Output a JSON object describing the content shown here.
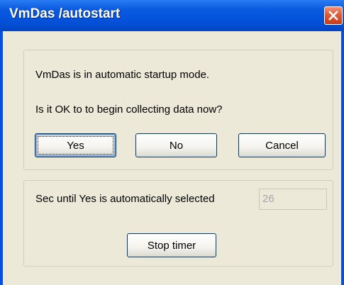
{
  "window": {
    "title": "VmDas /autostart",
    "close_icon": "close-icon",
    "colors": {
      "titlebar": "#0451d9",
      "close_button": "#e05a36",
      "client_background": "#ece9d8"
    }
  },
  "prompt": {
    "line1": "VmDas is in automatic startup mode.",
    "line2": "Is it OK to to begin collecting data now?"
  },
  "buttons": {
    "yes": "Yes",
    "no": "No",
    "cancel": "Cancel",
    "stop_timer": "Stop timer"
  },
  "timer": {
    "label": "Sec until Yes is automatically selected",
    "value": "26"
  }
}
